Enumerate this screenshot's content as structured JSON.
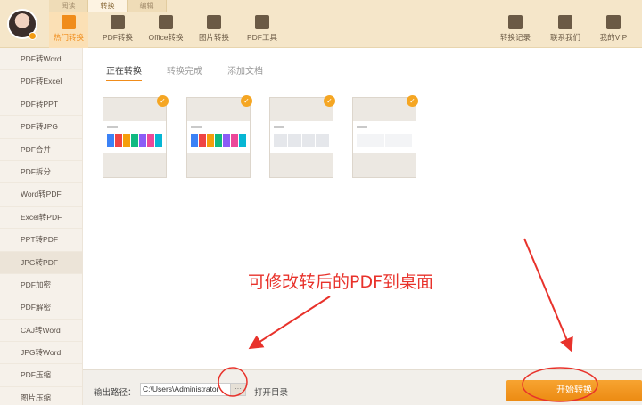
{
  "top_tabs": [
    "阅读",
    "转换",
    "编辑"
  ],
  "nav": {
    "hot": "热门转换",
    "pdf_convert": "PDF转换",
    "office_convert": "Office转换",
    "image_convert": "图片转换",
    "pdf_tools": "PDF工具",
    "history": "转换记录",
    "contact": "联系我们",
    "vip": "我的VIP"
  },
  "sidebar": [
    "PDF转Word",
    "PDF转Excel",
    "PDF转PPT",
    "PDF转JPG",
    "PDF合并",
    "PDF拆分",
    "Word转PDF",
    "Excel转PDF",
    "PPT转PDF",
    "JPG转PDF",
    "PDF加密",
    "PDF解密",
    "CAJ转Word",
    "JPG转Word",
    "PDF压缩",
    "图片压缩"
  ],
  "sidebar_active": "JPG转PDF",
  "main_tabs": [
    "正在转换",
    "转换完成",
    "添加文档"
  ],
  "thumbnails": [
    {
      "check": "✓",
      "colors": [
        "#3b82f6",
        "#ef4444",
        "#f59e0b",
        "#10b981",
        "#8b5cf6",
        "#ec4899",
        "#06b6d4"
      ]
    },
    {
      "check": "✓",
      "colors": [
        "#3b82f6",
        "#ef4444",
        "#f59e0b",
        "#10b981",
        "#8b5cf6",
        "#ec4899",
        "#06b6d4"
      ]
    },
    {
      "check": "✓",
      "colors": [
        "#e5e7eb",
        "#e5e7eb",
        "#e5e7eb",
        "#e5e7eb"
      ]
    },
    {
      "check": "✓",
      "colors": [
        "#f3f4f6",
        "#f3f4f6"
      ]
    }
  ],
  "annotation": "可修改转后的PDF到桌面",
  "bottom": {
    "out_label": "输出路径：",
    "path_value": "C:\\Users\\Administrator",
    "dots": "···",
    "open_dir": "打开目录",
    "start": "开始转换"
  },
  "colors": {
    "accent": "#f08c1a",
    "annotation": "#e8322b"
  }
}
